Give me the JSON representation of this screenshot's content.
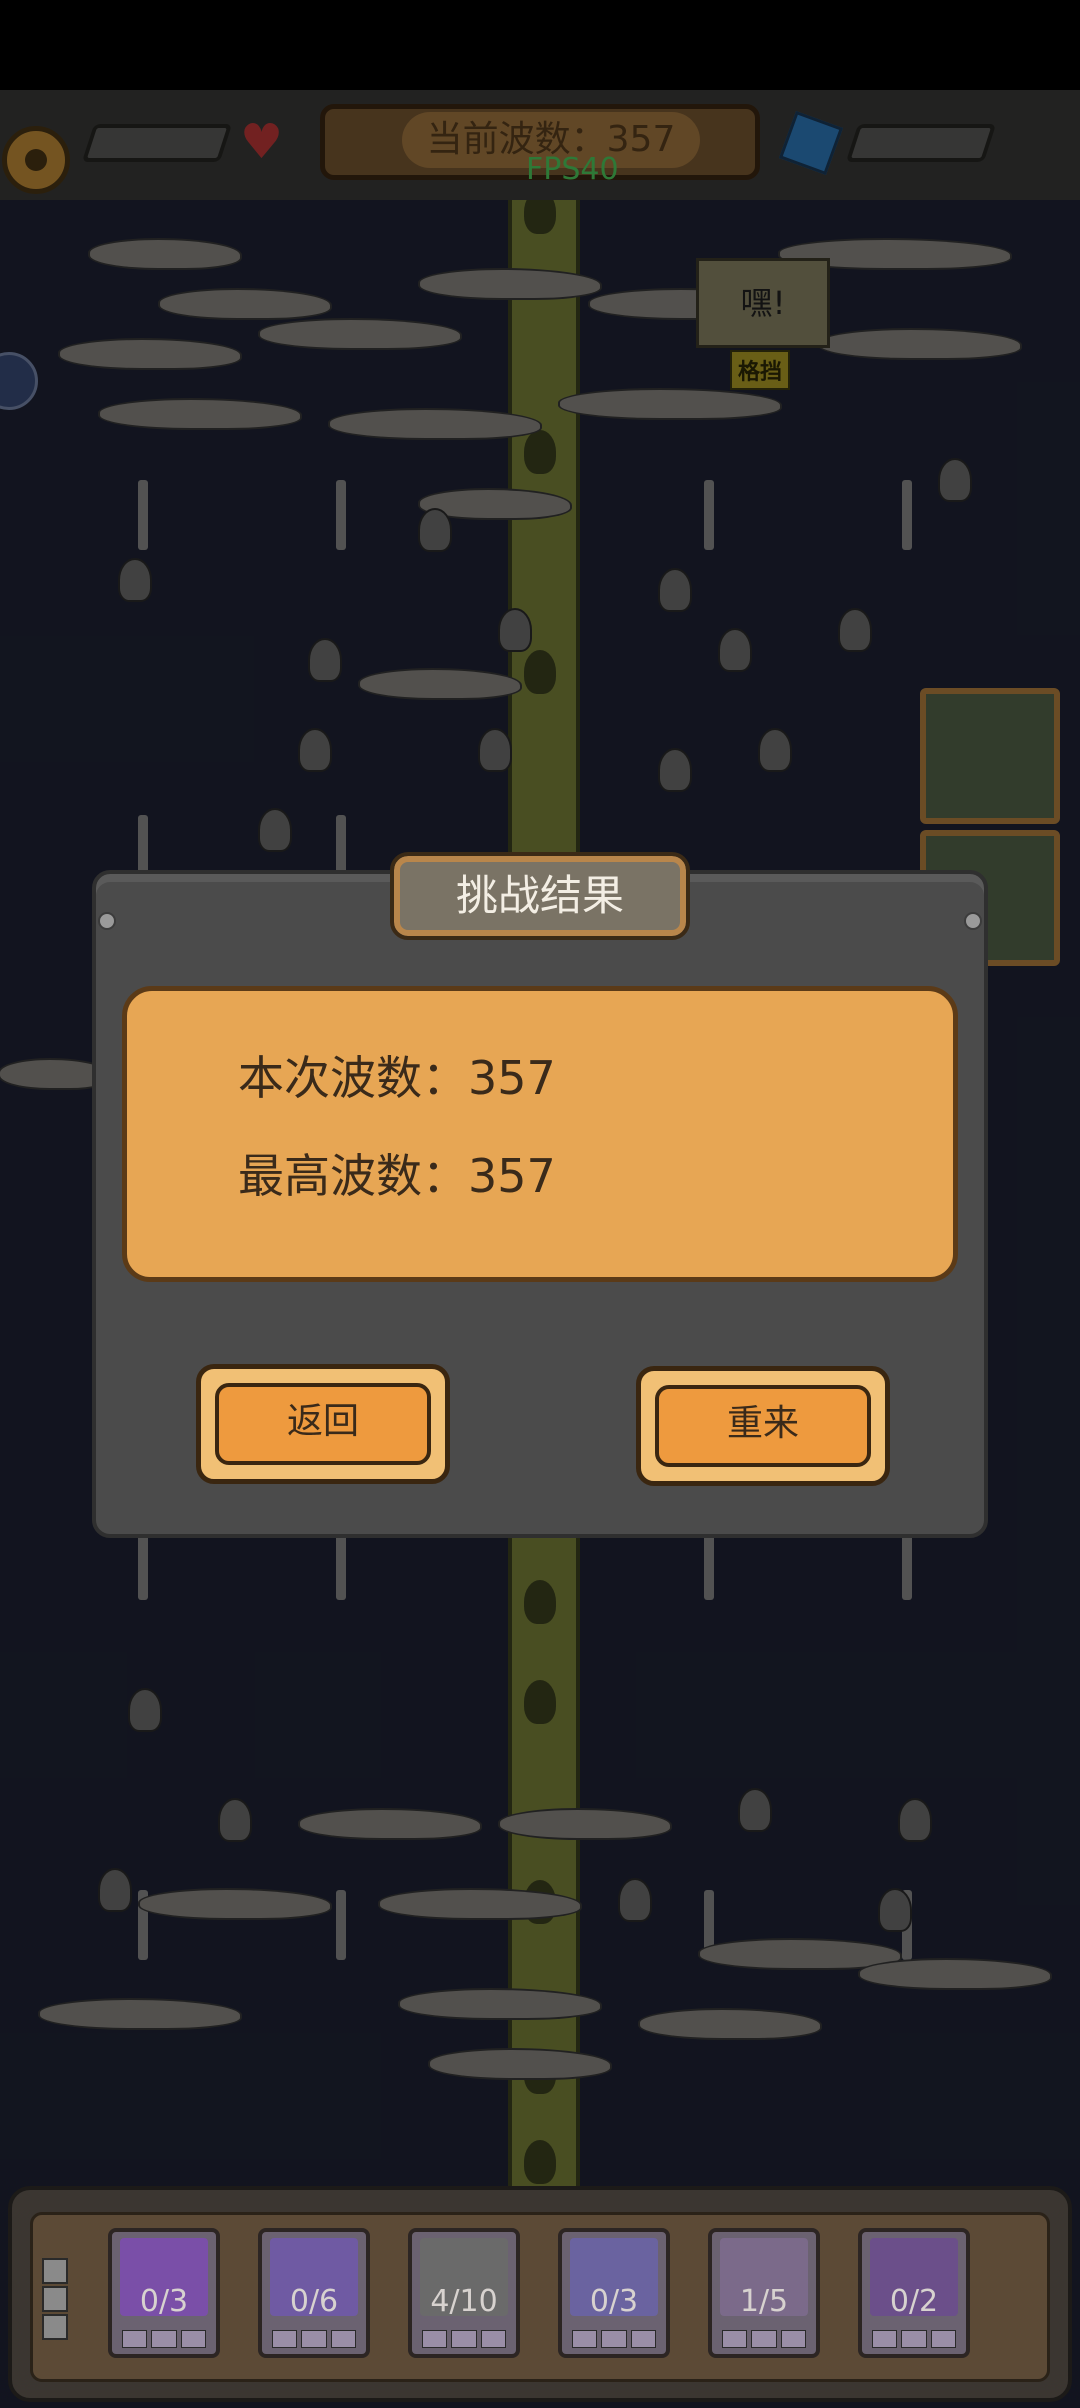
{
  "hud": {
    "wave_label": "当前波数：357",
    "fps": "FPS40"
  },
  "scene": {
    "speech_bubble": "嘿!",
    "status_tag": "格挡"
  },
  "dialog": {
    "title": "挑战结果",
    "current_wave": "本次波数：357",
    "best_wave": "最高波数：357",
    "back_button": "返回",
    "retry_button": "重来"
  },
  "units": [
    {
      "count": "0/3",
      "color": "#7a4fa8"
    },
    {
      "count": "0/6",
      "color": "#6f5aa3"
    },
    {
      "count": "4/10",
      "color": "#6a6a6a"
    },
    {
      "count": "0/3",
      "color": "#6a63a0"
    },
    {
      "count": "1/5",
      "color": "#7b6a8a"
    },
    {
      "count": "0/2",
      "color": "#6b4f8a"
    }
  ]
}
